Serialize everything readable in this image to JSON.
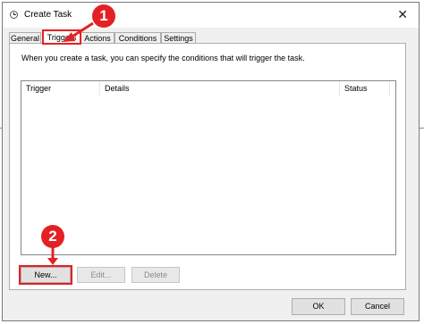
{
  "window": {
    "title": "Create Task"
  },
  "tabs": [
    "General",
    "Triggers",
    "Actions",
    "Conditions",
    "Settings"
  ],
  "active_tab": "Triggers",
  "panel": {
    "description": "When you create a task, you can specify the conditions that will trigger the task.",
    "columns": [
      "Trigger",
      "Details",
      "Status"
    ],
    "buttons": {
      "new": "New...",
      "edit": "Edit...",
      "delete": "Delete"
    }
  },
  "footer": {
    "ok": "OK",
    "cancel": "Cancel"
  },
  "callouts": [
    "1",
    "2"
  ],
  "colors": {
    "callout": "#e32124",
    "dialog_bg": "#f0f0f0"
  },
  "icons": [
    "clock-icon",
    "close-icon"
  ]
}
